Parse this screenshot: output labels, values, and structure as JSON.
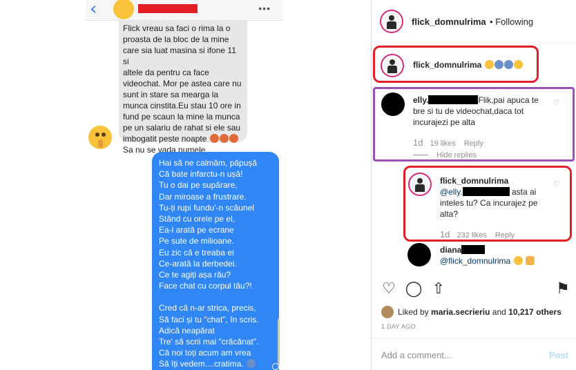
{
  "chat": {
    "back_glyph": "‹",
    "more_glyph": "•••",
    "received_lines": [
      "Flick vreau sa faci o rima la o",
      "proasta de la bloc de la mine",
      "care sia luat masina si ifone 11 si",
      "altele da pentru ca face",
      "videochat. Mor pe astea care nu",
      "sunt in stare sa mearga la",
      "munca cinstita.Eu stau 10 ore in",
      "fund pe scaun la mine la munca",
      "pe un salariu de rahat si ele sau",
      "imbogatit peste noapte",
      "Sa nu se vada numele"
    ],
    "sent_lines": [
      "Hai să ne calmăm, păpușă",
      "Că bate infarctu-n ușă!",
      "Tu o dai pe supărare,",
      "Dar miroase a frustrare.",
      "Tu-ți rupi fundu'-n scăunel",
      "Stând cu orele pe el,",
      "Ea-l arată pe ecrane",
      "Pe sute de milioane.",
      "Eu zic că e treaba ei",
      "Ce-arată la derbedei.",
      "Ce te agiți așa rău?",
      "Face chat cu corpul tău?!",
      "",
      "Cred că n-ar strica, precis,",
      "Să faci și tu \"chat\", în scris.",
      "Adică neapărat",
      "Tre' să scrii mai \"crăcănat\".",
      "Că noi toți acum am vrea",
      "Să îți vedem....cratima."
    ]
  },
  "ig": {
    "header": {
      "username": "flick_domnulrima",
      "separator": "•",
      "following": "Following"
    },
    "caption": {
      "username": "flick_domnulrima"
    },
    "comment1": {
      "username": "elly.",
      "text_after": "Flik,pai apuca te bre si tu de videochat,daca tot incurajezi pe alta",
      "age": "1d",
      "likes": "19 likes",
      "reply": "Reply",
      "hide_replies": "Hide replies"
    },
    "reply1": {
      "username": "flick_domnulrima",
      "mention": "@elly.",
      "text_after": " asta ai inteles tu? Ca incurajez pe alta?",
      "age": "1d",
      "likes": "232 likes",
      "reply": "Reply"
    },
    "reply2": {
      "username": "diana",
      "mention": "@flick_domnulrima"
    },
    "likes": {
      "prefix": "Liked by",
      "user": "maria.secrieriu",
      "middle": "and",
      "count": "10,217 others"
    },
    "time": "1 DAY AGO",
    "add_comment": {
      "placeholder": "Add a comment...",
      "post": "Post"
    },
    "icons": {
      "like": "♡",
      "comment": "◯",
      "share": "⇧",
      "save": "⚑",
      "heart_small": "♡",
      "more": "•••"
    }
  }
}
